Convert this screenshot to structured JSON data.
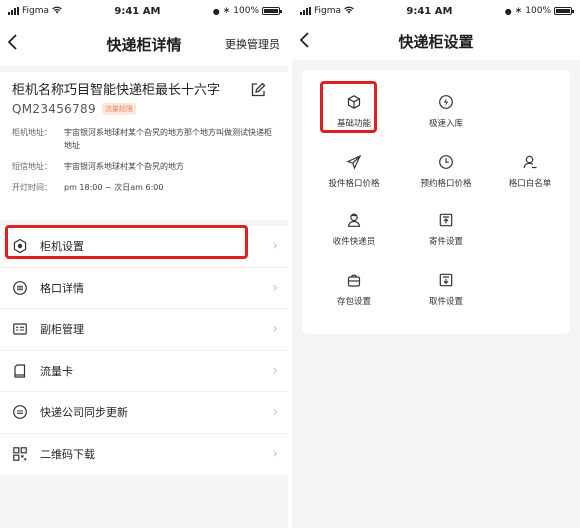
{
  "left": {
    "status": {
      "carrier": "Figma",
      "time": "9:41 AM",
      "battery": "100%"
    },
    "nav": {
      "back_icon": "chevron-left-icon",
      "title": "快递柜详情",
      "action": "更换管理员"
    },
    "cabinet": {
      "name": "柜机名称巧目智能快递柜最长十六字",
      "code": "QM23456789",
      "tag": "流量超限",
      "address_label": "柜机地址：",
      "address": "宇宙银河系地球村某个旮旯的地方那个地方叫做测试快递柜地址",
      "sms_address_label": "短信地址：",
      "sms_address": "宇宙银河系地球村某个旮旯的地方",
      "hours_label": "开灯时间：",
      "hours": "pm 18:00 ~ 次日am 6:00"
    },
    "menu": [
      {
        "label": "柜机设置",
        "icon": "cabinet-settings-icon"
      },
      {
        "label": "格口详情",
        "icon": "slot-detail-icon"
      },
      {
        "label": "副柜管理",
        "icon": "sub-cabinet-icon"
      },
      {
        "label": "流量卡",
        "icon": "sim-card-icon"
      },
      {
        "label": "快递公司同步更新",
        "icon": "sync-icon"
      },
      {
        "label": "二维码下载",
        "icon": "qr-code-icon"
      }
    ]
  },
  "right": {
    "status": {
      "carrier": "Figma",
      "time": "9:41 AM",
      "battery": "100%"
    },
    "nav": {
      "back_icon": "chevron-left-icon",
      "title": "快递柜设置"
    },
    "grid": [
      {
        "label": "基础功能",
        "icon": "box-icon"
      },
      {
        "label": "极速入库",
        "icon": "lightning-icon"
      },
      {
        "label": "投件格口价格",
        "icon": "send-icon"
      },
      {
        "label": "预约格口价格",
        "icon": "clock-icon"
      },
      {
        "label": "格口白名单",
        "icon": "user-icon"
      },
      {
        "label": "收件快递员",
        "icon": "courier-icon"
      },
      {
        "label": "寄件设置",
        "icon": "outbox-icon"
      },
      {
        "label": "存包设置",
        "icon": "bag-icon"
      },
      {
        "label": "取件设置",
        "icon": "pickup-icon"
      }
    ]
  },
  "colors": {
    "highlight": "#e02020",
    "accent": "#1a1a1a",
    "tag_bg": "#fde8df",
    "tag_text": "#f08a5d"
  }
}
